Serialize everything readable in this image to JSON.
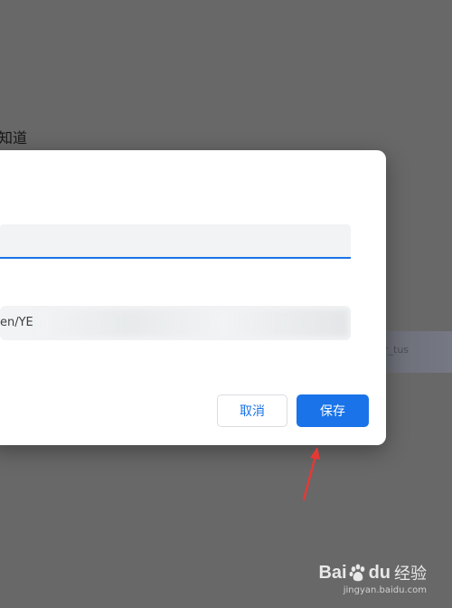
{
  "background": {
    "partial_text": "知道",
    "strip_text": "r_tus"
  },
  "dialog": {
    "name_value": "",
    "url_value": "en/YE",
    "cancel_label": "取消",
    "save_label": "保存"
  },
  "watermark": {
    "brand_bai": "Bai",
    "brand_du": "du",
    "brand_jingyan": "经验",
    "url": "jingyan.baidu.com"
  },
  "colors": {
    "accent": "#1a73e8",
    "overlay": "#686868",
    "annotation_arrow": "#e53935"
  },
  "icons": {
    "annotation": "red-arrow",
    "watermark": "baidu-paw-icon"
  }
}
